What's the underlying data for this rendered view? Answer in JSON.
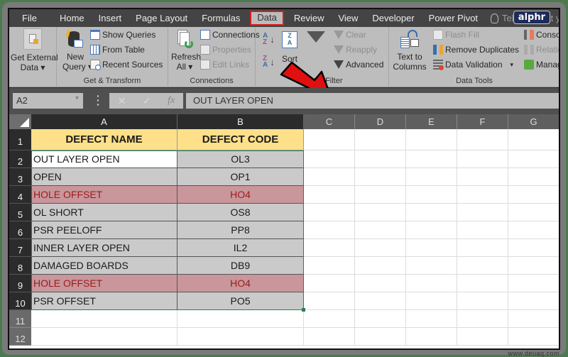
{
  "tabs": [
    {
      "label": "File"
    },
    {
      "label": "Home"
    },
    {
      "label": "Insert"
    },
    {
      "label": "Page Layout"
    },
    {
      "label": "Formulas"
    },
    {
      "label": "Data",
      "active": true
    },
    {
      "label": "Review"
    },
    {
      "label": "View"
    },
    {
      "label": "Developer"
    },
    {
      "label": "Power Pivot"
    }
  ],
  "tell_me": "Tell me what you want to",
  "ribbon": {
    "get_external_data": {
      "line1": "Get External",
      "line2": "Data ▾"
    },
    "get_transform": {
      "label": "Get & Transform",
      "new_query": {
        "line1": "New",
        "line2": "Query ▾"
      },
      "show_queries": "Show Queries",
      "from_table": "From Table",
      "recent_sources": "Recent Sources"
    },
    "connections": {
      "label": "Connections",
      "refresh_all": {
        "line1": "Refresh",
        "line2": "All ▾"
      },
      "connections": "Connections",
      "properties": "Properties",
      "edit_links": "Edit Links"
    },
    "sort_filter": {
      "label": "Sort & Filter",
      "sort": "Sort",
      "clear": "Clear",
      "reapply": "Reapply",
      "advanced": "Advanced"
    },
    "data_tools": {
      "label": "Data Tools",
      "text_to_columns": {
        "line1": "Text to",
        "line2": "Columns"
      },
      "flash_fill": "Flash Fill",
      "remove_duplicates": "Remove Duplicates",
      "data_validation": "Data Validation",
      "data_validation_dd": "▾",
      "consolidate": "Consolid",
      "relationships": "Relations",
      "manage": "Manage"
    }
  },
  "formula_bar": {
    "name_box": "A2",
    "name_box_dd": "▾",
    "cancel": "✕",
    "enter": "✓",
    "fx": "fx",
    "value": "OUT LAYER OPEN"
  },
  "columns": [
    "A",
    "B",
    "C",
    "D",
    "E",
    "F",
    "G"
  ],
  "rows": [
    "1",
    "2",
    "3",
    "4",
    "5",
    "6",
    "7",
    "8",
    "9",
    "10",
    "11",
    "12"
  ],
  "table": {
    "headers": [
      "DEFECT NAME",
      "DEFECT CODE"
    ],
    "rows": [
      {
        "name": "OUT LAYER OPEN",
        "code": "OL3",
        "highlight": false
      },
      {
        "name": "OPEN",
        "code": "OP1",
        "highlight": false
      },
      {
        "name": "HOLE OFFSET",
        "code": "HO4",
        "highlight": true
      },
      {
        "name": "OL SHORT",
        "code": "OS8",
        "highlight": false
      },
      {
        "name": "PSR PEELOFF",
        "code": "PP8",
        "highlight": false
      },
      {
        "name": "INNER LAYER OPEN",
        "code": "IL2",
        "highlight": false
      },
      {
        "name": "DAMAGED BOARDS",
        "code": "DB9",
        "highlight": false
      },
      {
        "name": "HOLE OFFSET",
        "code": "HO4",
        "highlight": true
      },
      {
        "name": "PSR OFFSET",
        "code": "PO5",
        "highlight": false
      }
    ]
  },
  "colors": {
    "header_fill": "#ffe08a",
    "duplicate_fill": "#c8969b",
    "duplicate_text": "#9b1c1c",
    "selection": "#2e7d4f",
    "active_tab_outline": "#d42020",
    "arrow": "#e01010"
  },
  "watermarks": {
    "alphr": "alphr",
    "site": "www.deuaq.com"
  }
}
